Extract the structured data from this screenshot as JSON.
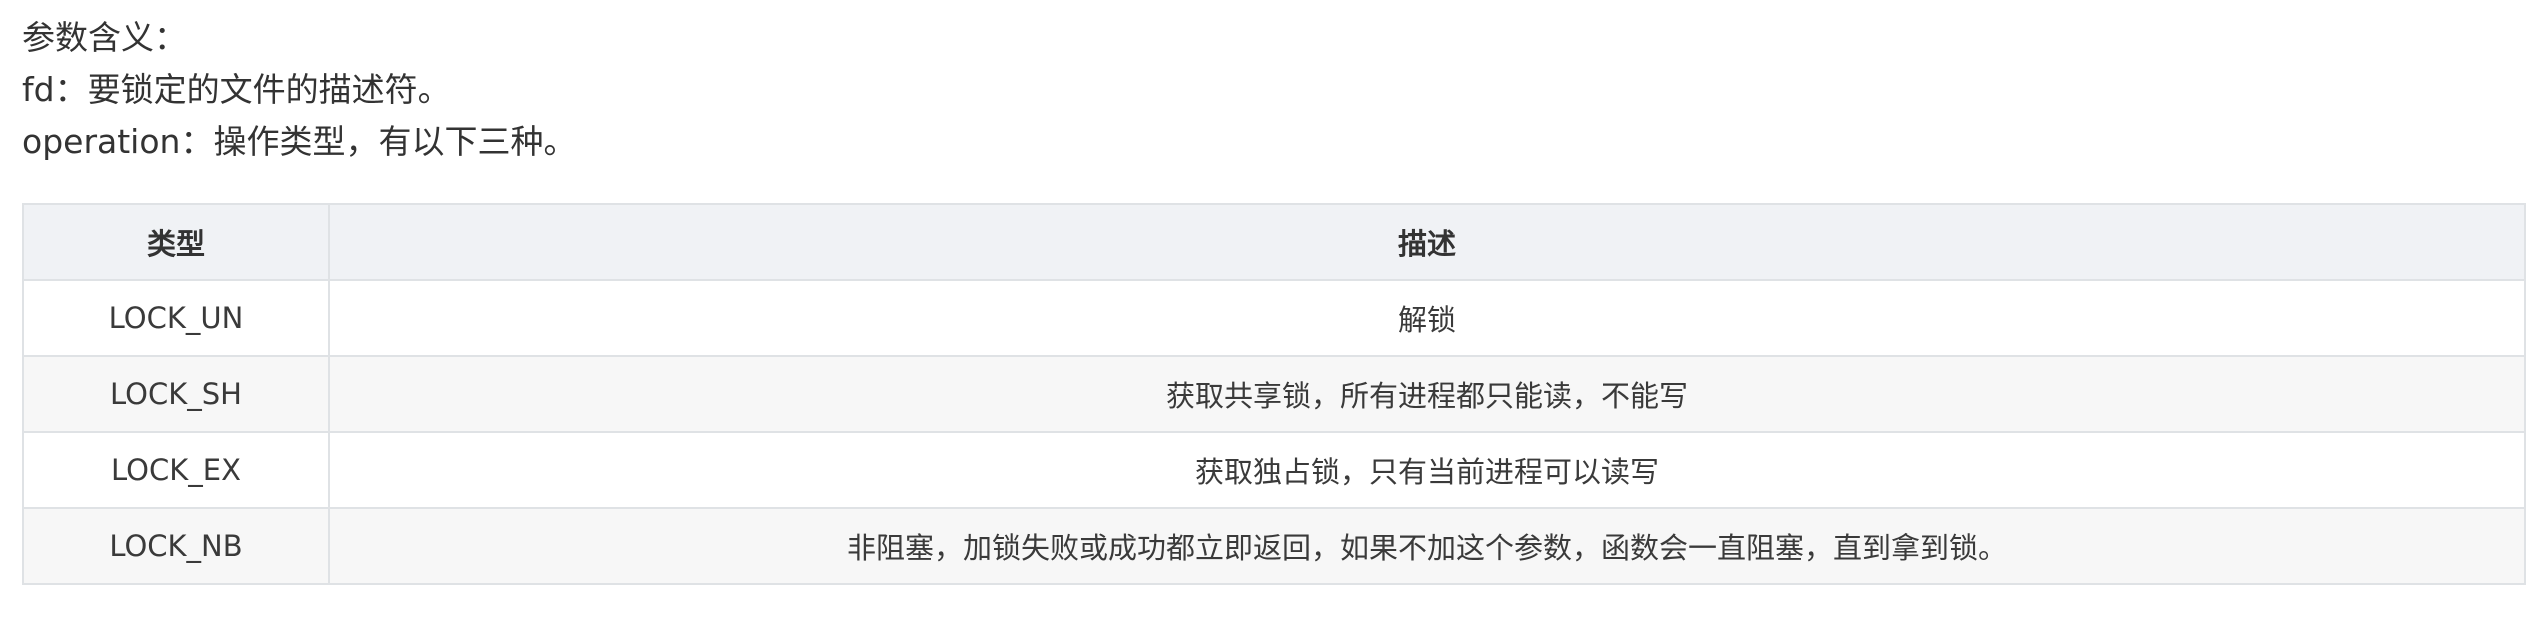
{
  "intro": {
    "heading": "参数含义：",
    "fd_line": "fd：要锁定的文件的描述符。",
    "operation_line": "operation：操作类型，有以下三种。"
  },
  "table": {
    "headers": [
      "类型",
      "描述"
    ],
    "rows": [
      {
        "type": "LOCK_UN",
        "desc": "解锁"
      },
      {
        "type": "LOCK_SH",
        "desc": "获取共享锁，所有进程都只能读，不能写"
      },
      {
        "type": "LOCK_EX",
        "desc": "获取独占锁，只有当前进程可以读写"
      },
      {
        "type": "LOCK_NB",
        "desc": "非阻塞，加锁失败或成功都立即返回，如果不加这个参数，函数会一直阻塞，直到拿到锁。"
      }
    ]
  }
}
